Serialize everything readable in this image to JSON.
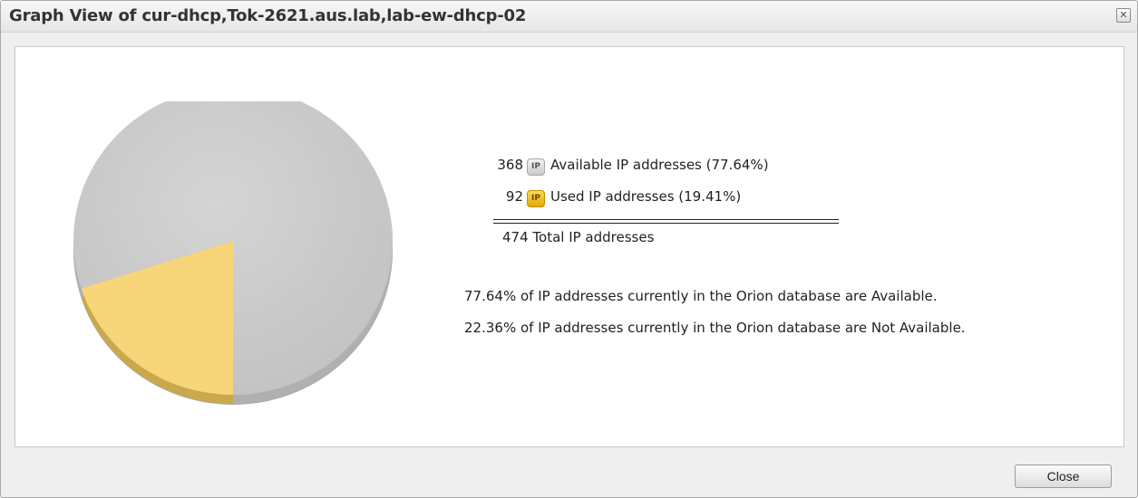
{
  "dialog": {
    "title": "Graph View of cur-dhcp,Tok-2621.aus.lab,lab-ew-dhcp-02",
    "close_icon": "close-icon",
    "close_button_label": "Close"
  },
  "summary": {
    "available": {
      "count": "368",
      "icon": "IP",
      "label": "Available IP addresses (77.64%)"
    },
    "used": {
      "count": "92",
      "icon": "IP",
      "label": "Used IP addresses (19.41%)"
    },
    "total": "474 Total IP addresses",
    "note_available": "77.64% of IP addresses currently in the Orion database are Available.",
    "note_not_available": "22.36% of IP addresses currently in the Orion database are Not Available."
  },
  "chart_data": {
    "type": "pie",
    "categories": [
      "Available IP addresses",
      "Used IP addresses"
    ],
    "values": [
      368,
      92
    ],
    "colors": [
      "#cccccc",
      "#f7d57a"
    ]
  }
}
